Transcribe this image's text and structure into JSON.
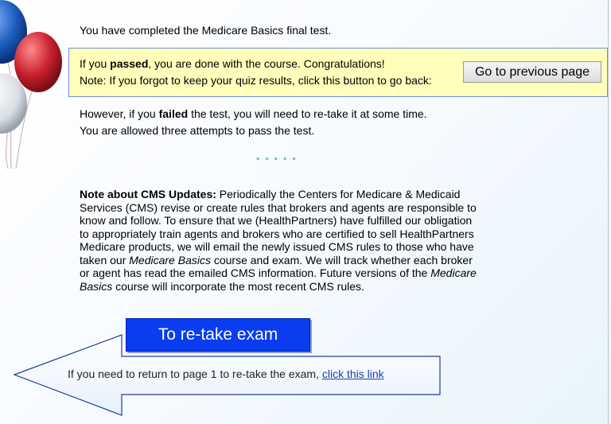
{
  "completed": {
    "text": "You have completed the Medicare Basics final test."
  },
  "notice": {
    "line1_pre": "If you ",
    "line1_bold": "passed",
    "line1_post": ", you are done with the course. Congratulations!",
    "line2": "Note: If you forgot to keep your quiz results, click this button to go back:",
    "button_label": "Go to previous page"
  },
  "failed": {
    "line1_pre": "However, if you ",
    "line1_bold": "failed",
    "line1_post": " the test, you will need to re-take it at some time.",
    "line2": "You are allowed three attempts to pass the test."
  },
  "divider": {
    "stars": "* * * * *"
  },
  "cms": {
    "heading": "Note about CMS Updates:",
    "text1": " Periodically the Centers for Medicare & Medicaid Services (CMS) revise or create rules that brokers and agents are responsible to know and follow. To ensure that we (HealthPartners) have fulfilled our obligation to appropriately train agents and brokers who are certified to sell HealthPartners Medicare products, we will email the newly issued CMS rules to those who have taken our ",
    "em1": "Medicare Basics",
    "text2": " course and exam. We will track whether each broker or agent has read the emailed CMS information. Future versions of the ",
    "em2": "Medicare Basics",
    "text3": " course will incorporate the most recent CMS rules."
  },
  "retake": {
    "label": "To re-take exam"
  },
  "arrow": {
    "text": "If you need to return to page 1 to re-take the exam, ",
    "link": "click this link"
  },
  "colors": {
    "notice_bg": "#ffffbb",
    "retake_bg": "#0a3cf0",
    "link": "#1a3fa8",
    "stars": "#2a9d8f",
    "balloon_blue": "#1f5fbf",
    "balloon_red": "#c8202e",
    "balloon_white": "#dfe3e8"
  }
}
